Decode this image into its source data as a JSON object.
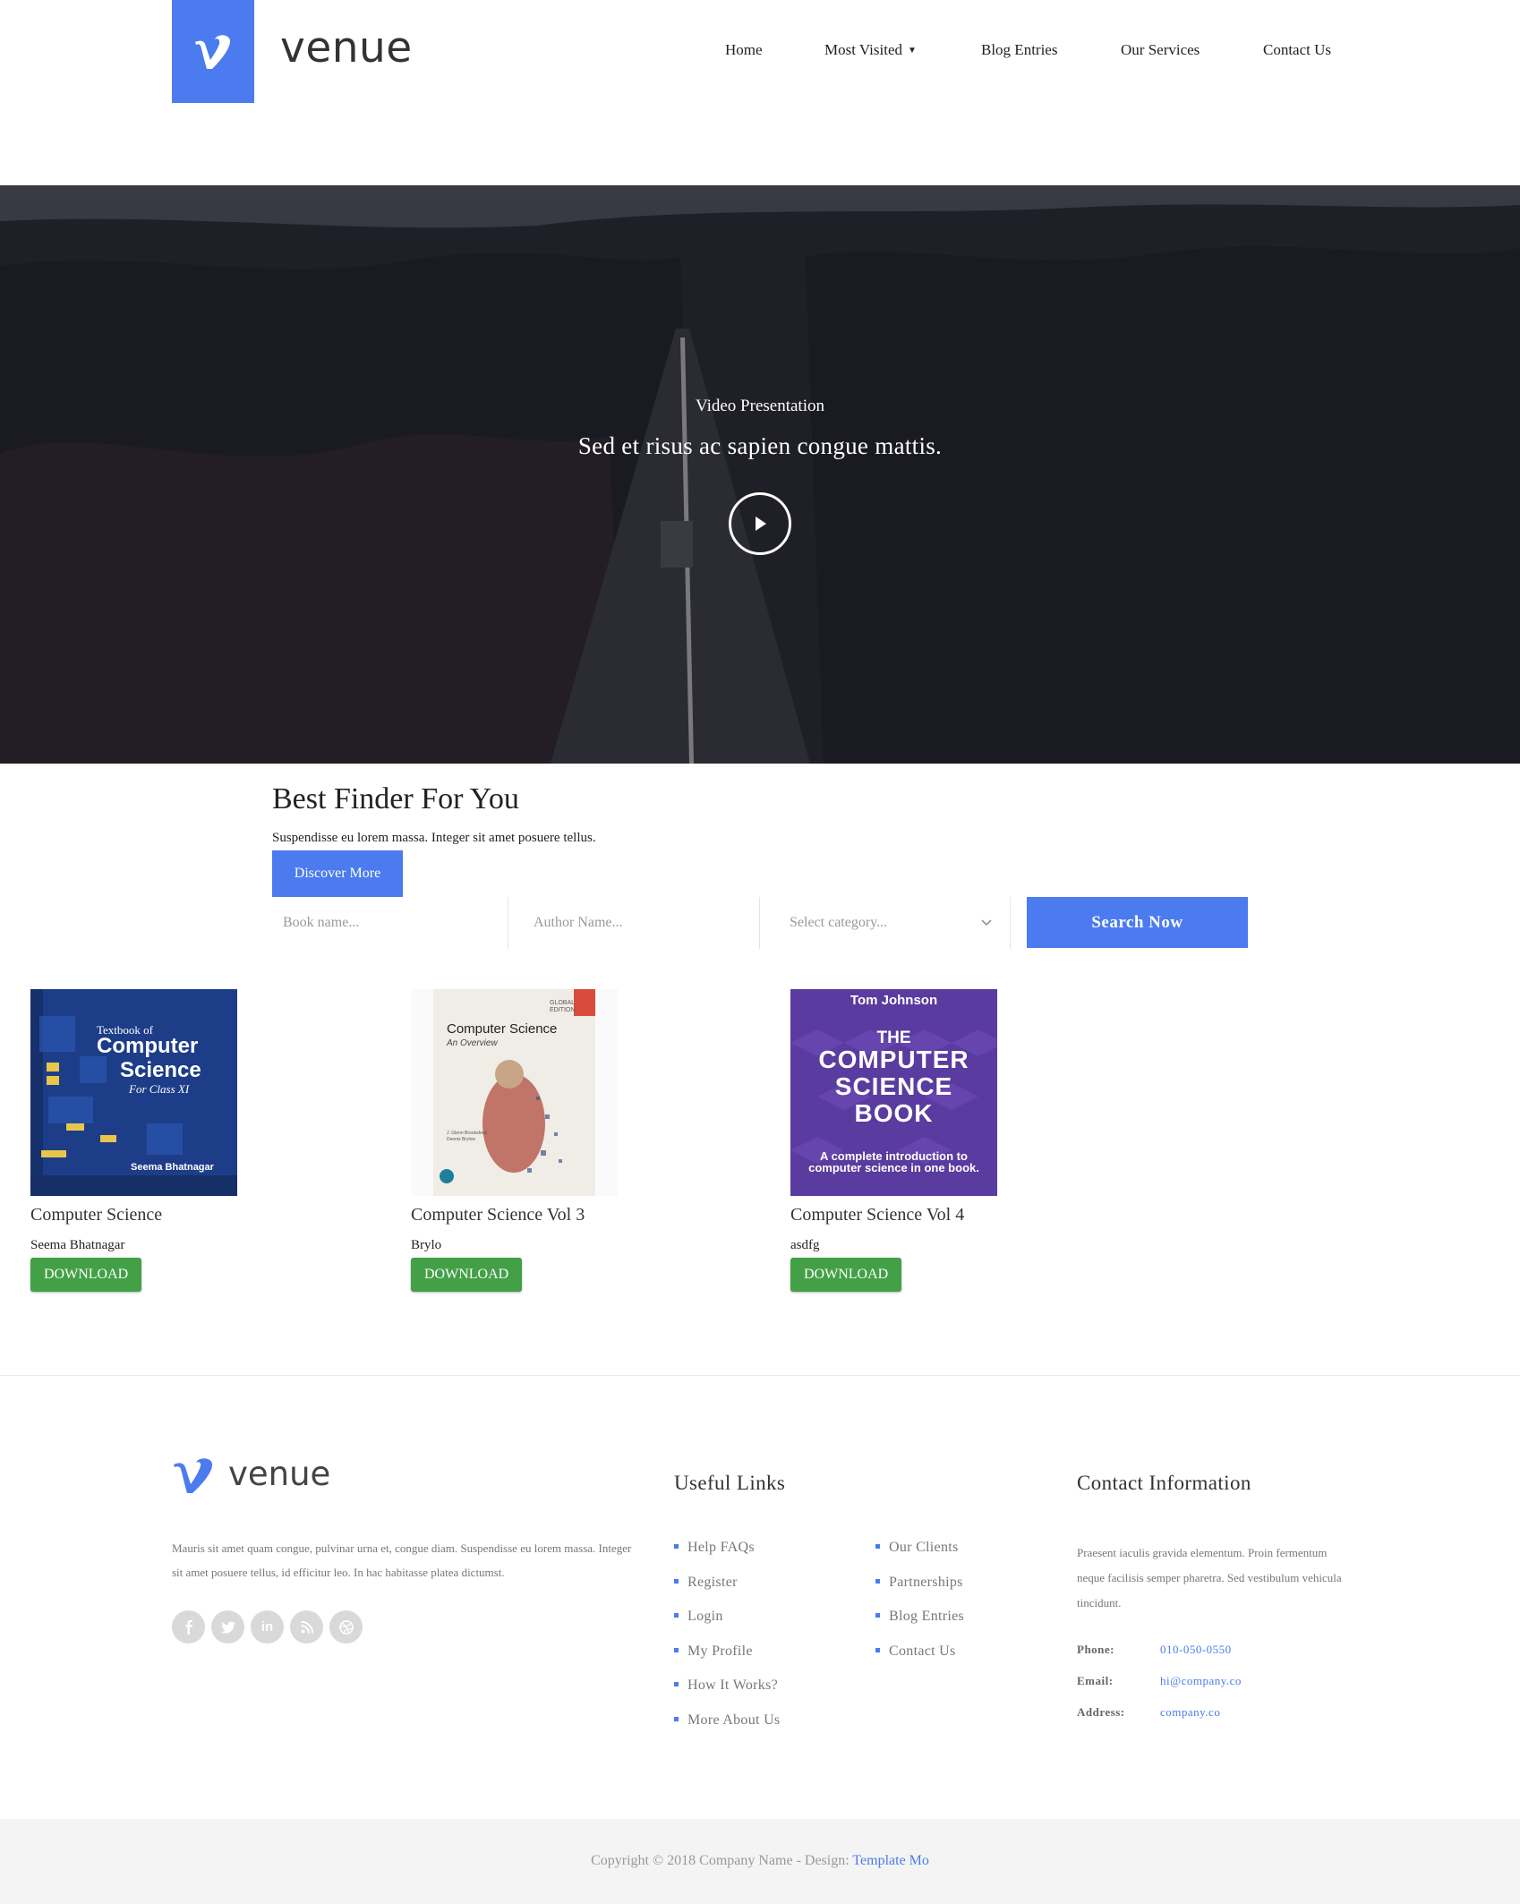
{
  "brand": {
    "name": "venue",
    "accent_color": "#4b7bef"
  },
  "nav": [
    {
      "label": "Home"
    },
    {
      "label": "Most Visited",
      "icon": "caret-down-icon"
    },
    {
      "label": "Blog Entries"
    },
    {
      "label": "Our Services"
    },
    {
      "label": "Contact Us"
    }
  ],
  "hero": {
    "eyebrow": "Video Presentation",
    "title": "Sed et risus ac sapien congue mattis.",
    "play_icon": "play-icon"
  },
  "finder": {
    "title": "Best Finder For You",
    "subtitle": "Suspendisse eu lorem massa. Integer sit amet posuere tellus.",
    "discover_label": "Discover More",
    "book_placeholder": "Book name...",
    "author_placeholder": "Author Name...",
    "category_placeholder": "Select category...",
    "search_label": "Search Now"
  },
  "books": [
    {
      "title": "Computer Science",
      "author": "Seema Bhatnagar",
      "download_label": "DOWNLOAD",
      "cover": {
        "line1": "Textbook of",
        "line2": "Computer",
        "line3": "Science",
        "line4": "For Class XI",
        "author": "Seema Bhatnagar"
      }
    },
    {
      "title": "Computer Science Vol 3",
      "author": "Brylo",
      "download_label": "DOWNLOAD",
      "cover": {
        "badge": "GLOBAL EDITION",
        "line1": "Computer Science",
        "line2": "An Overview",
        "author": "J. Glenn Brookshear Dennis Brylow"
      }
    },
    {
      "title": "Computer Science Vol 4",
      "author": "asdfg",
      "download_label": "DOWNLOAD",
      "cover": {
        "top": "Tom Johnson",
        "line1": "THE",
        "line2": "COMPUTER",
        "line3": "SCIENCE",
        "line4": "BOOK",
        "tagline": "A complete introduction to computer science in one book."
      }
    }
  ],
  "footer": {
    "brand": "venue",
    "about": "Mauris sit amet quam congue, pulvinar urna et, congue diam. Suspendisse eu lorem massa. Integer sit amet posuere tellus, id efficitur leo. In hac habitasse platea dictumst.",
    "socials": [
      "facebook-icon",
      "twitter-icon",
      "linkedin-icon",
      "rss-icon",
      "dribbble-icon"
    ],
    "links_heading": "Useful Links",
    "links_col1": [
      "Help FAQs",
      "Register",
      "Login",
      "My Profile",
      "How It Works?",
      "More About Us"
    ],
    "links_col2": [
      "Our Clients",
      "Partnerships",
      "Blog Entries",
      "Contact Us"
    ],
    "contact_heading": "Contact Information",
    "contact_text": "Praesent iaculis gravida elementum. Proin fermentum neque facilisis semper pharetra. Sed vestibulum vehicula tincidunt.",
    "phone_label": "Phone:",
    "phone": "010-050-0550",
    "email_label": "Email:",
    "email": "hi@company.co",
    "address_label": "Address:",
    "address": "company.co"
  },
  "copyright": {
    "text": "Copyright © 2018 Company Name - Design: ",
    "link": "Template Mo"
  }
}
